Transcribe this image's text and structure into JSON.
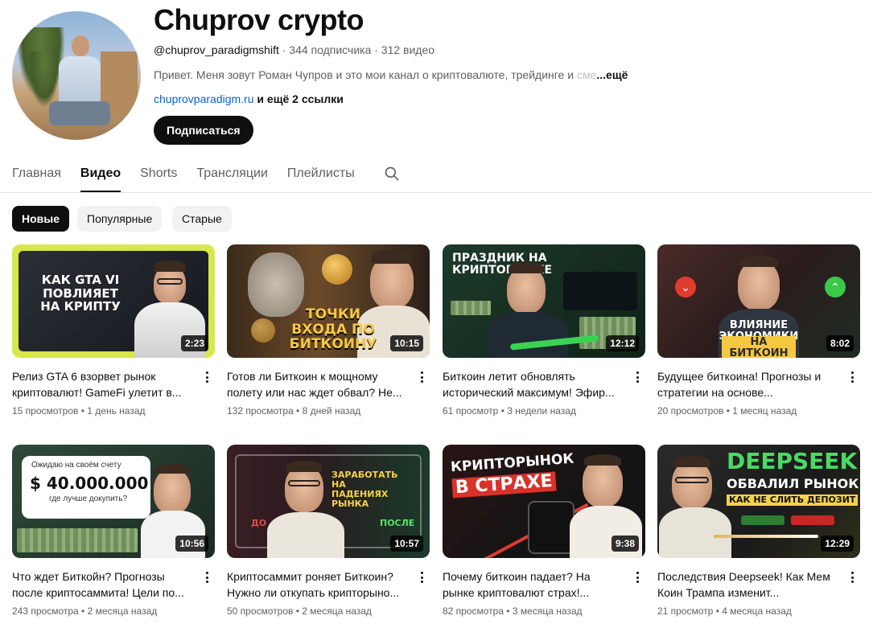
{
  "channel": {
    "title": "Chuprov crypto",
    "handle": "@chuprov_paradigmshift",
    "stats": " · 344 подписчика · 312 видео",
    "description": "Привет. Меня зовут Роман Чупров и это мои канал о криптовалюте, трейдинге и ",
    "description_fade": "сме",
    "description_more": "...ещё",
    "link": "chuprovparadigm.ru",
    "more_links": " и ещё 2 ссылки",
    "subscribe_label": "Подписаться"
  },
  "tabs": [
    "Главная",
    "Видео",
    "Shorts",
    "Трансляции",
    "Плейлисты"
  ],
  "active_tab": "Видео",
  "chips": [
    "Новые",
    "Популярные",
    "Старые"
  ],
  "videos": [
    {
      "title": "Релиз GTA 6 взорвет рынок криптовалют! GameFi улетит в...",
      "views": "15 просмотров",
      "age": "1 день назад",
      "duration": "2:23",
      "thumb_text": "КАК GTA VI ПОВЛИЯЕТ НА КРИПТУ"
    },
    {
      "title": "Готов ли Биткоин к мощному полету или нас ждет обвал? Не...",
      "views": "132 просмотра",
      "age": "8 дней назад",
      "duration": "10:15",
      "thumb_text": "ТОЧКИ ВХОДА ПО БИТКОИНУ"
    },
    {
      "title": "Биткоин летит обновлять исторический максимум! Эфир...",
      "views": "61 просмотр",
      "age": "3 недели назад",
      "duration": "12:12",
      "thumb_text": "ПРАЗДНИК НА КРИПТОРЫНКЕ"
    },
    {
      "title": "Будущее биткоина! Прогнозы и стратегии на основе...",
      "views": "20 просмотров",
      "age": "1 месяц назад",
      "duration": "8:02",
      "thumb_text_1": "ВЛИЯНИЕ ЭКОНОМИКИ",
      "thumb_text_2": "НА БИТКОИН"
    },
    {
      "title": "Что ждет Биткойн? Прогнозы после криптосаммита! Цели по...",
      "views": "243 просмотра",
      "age": "2 месяца назад",
      "duration": "10:56",
      "thumb_text_1": "Ожидаю на своём счету",
      "thumb_text_2": "$ 40.000.000",
      "thumb_text_3": "где лучше докупить?"
    },
    {
      "title": "Криптосаммит роняет Биткоин? Нужно ли откупать крипторыно...",
      "views": "50 просмотров",
      "age": "2 месяца назад",
      "duration": "10:57",
      "thumb_text_1": "ЗАРАБОТАТЬ НА ПАДЕНИЯХ РЫНКА",
      "thumb_text_2": "ДО",
      "thumb_text_3": "ПОСЛЕ"
    },
    {
      "title": "Почему биткоин падает? На рынке криптовалют страх!...",
      "views": "82 просмотра",
      "age": "3 месяца назад",
      "duration": "9:38",
      "thumb_text_1": "КРИПТОРЫНОК",
      "thumb_text_2": "В СТРАХЕ"
    },
    {
      "title": "Последствия Deepseek! Как Мем Коин Трампа изменит...",
      "views": "21 просмотр",
      "age": "4 месяца назад",
      "duration": "12:29",
      "thumb_text_1": "DEEPSEEK",
      "thumb_text_2": "ОБВАЛИЛ РЫНОК",
      "thumb_text_3": "КАК НЕ СЛИТЬ ДЕПОЗИТ"
    }
  ],
  "meta_separator": " • "
}
